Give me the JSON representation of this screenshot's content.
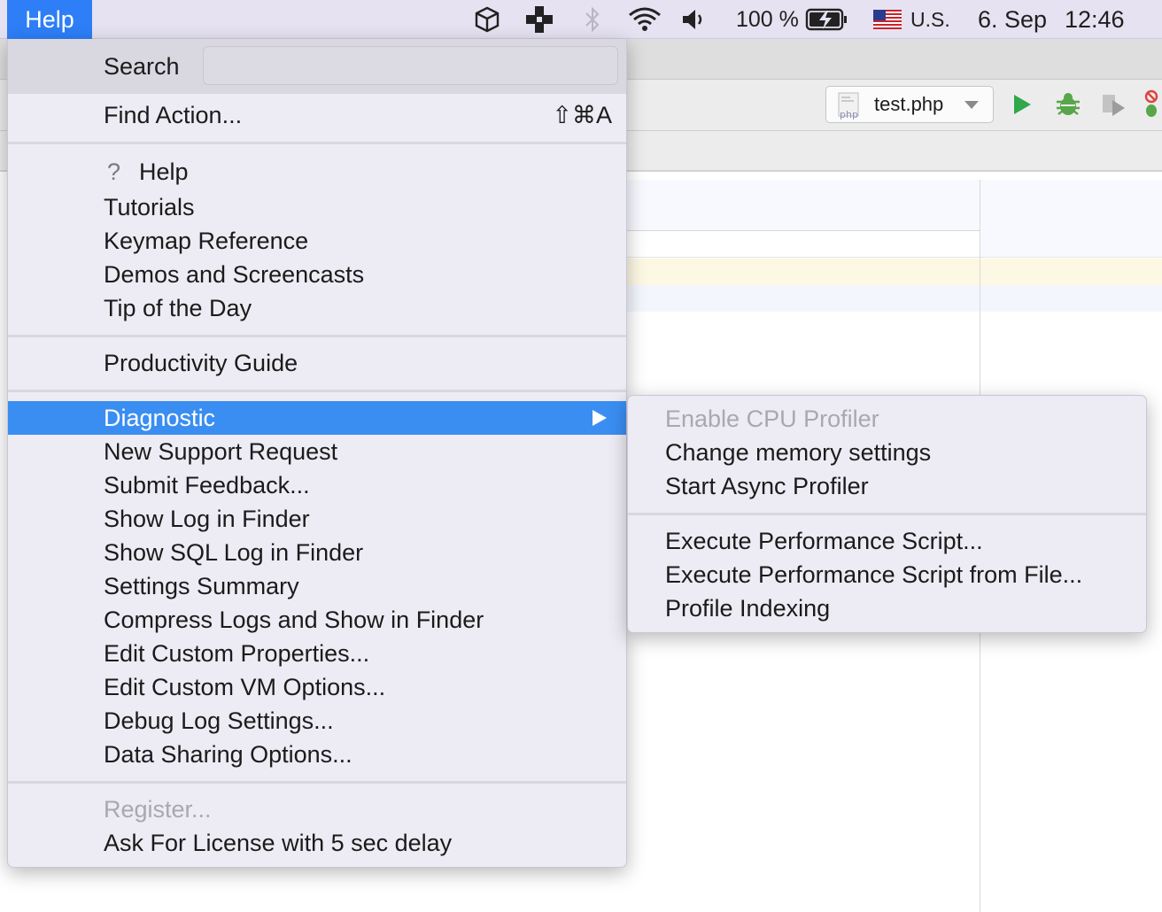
{
  "menubar": {
    "active_menu": "Help",
    "status_icons": [
      "cube-icon",
      "plus-app-icon",
      "bluetooth-icon",
      "wifi-icon",
      "volume-icon"
    ],
    "battery_percent": "100 %",
    "keyboard_layout": "U.S.",
    "date": "6. Sep",
    "time": "12:46"
  },
  "ide": {
    "run_config": "test.php",
    "php_icon_text": "php"
  },
  "help_menu": {
    "search_label": "Search",
    "search_value": "",
    "find_action": {
      "label": "Find Action...",
      "shortcut": "⇧⌘A"
    },
    "section_help": [
      {
        "label": "Help"
      },
      {
        "label": "Tutorials"
      },
      {
        "label": "Keymap Reference"
      },
      {
        "label": "Demos and Screencasts"
      },
      {
        "label": "Tip of the Day"
      }
    ],
    "productivity": "Productivity Guide",
    "section_diag": [
      {
        "label": "Diagnostic",
        "selected": true,
        "submenu": true
      },
      {
        "label": "New Support Request"
      },
      {
        "label": "Submit Feedback..."
      },
      {
        "label": "Show Log in Finder"
      },
      {
        "label": "Show SQL Log in Finder"
      },
      {
        "label": "Settings Summary"
      },
      {
        "label": "Compress Logs and Show in Finder"
      },
      {
        "label": "Edit Custom Properties..."
      },
      {
        "label": "Edit Custom VM Options..."
      },
      {
        "label": "Debug Log Settings..."
      },
      {
        "label": "Data Sharing Options..."
      }
    ],
    "section_license": [
      {
        "label": "Register...",
        "disabled": true
      },
      {
        "label": "Ask For License with 5 sec delay"
      }
    ]
  },
  "diagnostic_submenu": {
    "group1": [
      {
        "label": "Enable CPU Profiler",
        "disabled": true
      },
      {
        "label": "Change memory settings"
      },
      {
        "label": "Start Async Profiler"
      }
    ],
    "group2": [
      {
        "label": "Execute Performance Script..."
      },
      {
        "label": "Execute Performance Script from File..."
      },
      {
        "label": "Profile Indexing"
      }
    ]
  },
  "colors": {
    "selection": "#3a8ef2",
    "menubar_active": "#2d7ef7",
    "run_green": "#2ea84a",
    "debug_green": "#57a64a"
  }
}
